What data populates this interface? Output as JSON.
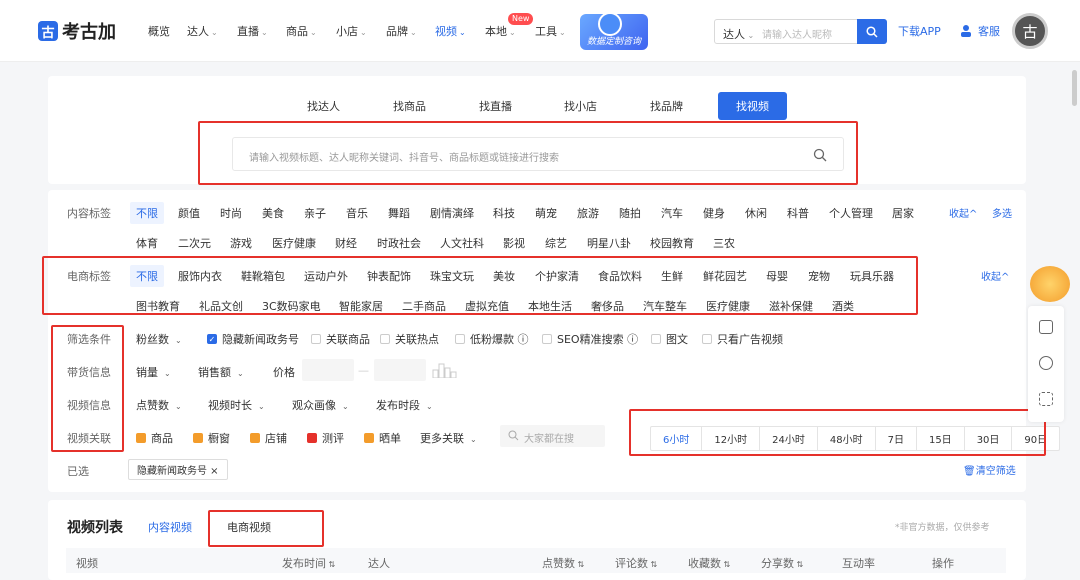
{
  "brand": {
    "name": "考古加",
    "mark": "古"
  },
  "nav": {
    "items": [
      {
        "label": "概览",
        "has_caret": false
      },
      {
        "label": "达人",
        "has_caret": true
      },
      {
        "label": "直播",
        "has_caret": true
      },
      {
        "label": "商品",
        "has_caret": true
      },
      {
        "label": "小店",
        "has_caret": true
      },
      {
        "label": "品牌",
        "has_caret": true
      },
      {
        "label": "视频",
        "has_caret": true,
        "active": true
      },
      {
        "label": "本地",
        "has_caret": true
      },
      {
        "label": "工具",
        "has_caret": true
      }
    ],
    "new_badge": "New",
    "promo_text": "数据定制咨询",
    "search_scope": "达人",
    "search_placeholder": "请输入达人昵称",
    "download": "下载APP",
    "service": "客服",
    "avatar_char": "古"
  },
  "find_tabs": [
    {
      "label": "找达人"
    },
    {
      "label": "找商品"
    },
    {
      "label": "找直播"
    },
    {
      "label": "找小店"
    },
    {
      "label": "找品牌"
    },
    {
      "label": "找视频",
      "active": true
    }
  ],
  "main_search": {
    "placeholder": "请输入视频标题、达人昵称关键词、抖音号、商品标题或链接进行搜索"
  },
  "content_tags": {
    "label": "内容标签",
    "row1": [
      "不限",
      "颜值",
      "时尚",
      "美食",
      "亲子",
      "音乐",
      "舞蹈",
      "剧情演绎",
      "科技",
      "萌宠",
      "旅游",
      "随拍",
      "汽车",
      "健身",
      "休闲",
      "科普",
      "个人管理",
      "居家"
    ],
    "row2": [
      "体育",
      "二次元",
      "游戏",
      "医疗健康",
      "财经",
      "时政社会",
      "人文社科",
      "影视",
      "综艺",
      "明星八卦",
      "校园教育",
      "三农"
    ],
    "collapse": "收起^",
    "multi": "多选"
  },
  "ecom_tags": {
    "label": "电商标签",
    "row1": [
      "不限",
      "服饰内衣",
      "鞋靴箱包",
      "运动户外",
      "钟表配饰",
      "珠宝文玩",
      "美妆",
      "个护家清",
      "食品饮料",
      "生鲜",
      "鲜花园艺",
      "母婴",
      "宠物",
      "玩具乐器"
    ],
    "row2": [
      "图书教育",
      "礼品文创",
      "3C数码家电",
      "智能家居",
      "二手商品",
      "虚拟充值",
      "本地生活",
      "奢侈品",
      "汽车整车",
      "医疗健康",
      "滋补保健",
      "酒类"
    ],
    "collapse": "收起^"
  },
  "filters": {
    "screen_label": "筛选条件",
    "fans": "粉丝数",
    "checks": [
      {
        "label": "隐藏新闻政务号",
        "checked": true
      },
      {
        "label": "关联商品",
        "checked": false
      },
      {
        "label": "关联热点",
        "checked": false
      },
      {
        "label": "低粉爆款 ⓘ",
        "checked": false
      },
      {
        "label": "SEO精准搜索 ⓘ",
        "checked": false
      },
      {
        "label": "图文",
        "checked": false
      },
      {
        "label": "只看广告视频",
        "checked": false
      }
    ],
    "sales_label": "带货信息",
    "sales": [
      "销量",
      "销售额"
    ],
    "price_label": "价格",
    "price_sep": "—",
    "video_label": "视频信息",
    "video_drops": [
      "点赞数",
      "视频时长",
      "观众画像",
      "发布时段"
    ],
    "relate_label": "视频关联",
    "relates": [
      {
        "label": "商品",
        "color": "#f39c2b"
      },
      {
        "label": "橱窗",
        "color": "#f39c2b"
      },
      {
        "label": "店铺",
        "color": "#f39c2b"
      },
      {
        "label": "测评",
        "color": "#e5312b"
      },
      {
        "label": "晒单",
        "color": "#f39c2b"
      }
    ],
    "more": "更多关联",
    "search_placeholder": "大家都在搜",
    "time_ranges": [
      {
        "label": "6小时",
        "active": true
      },
      {
        "label": "12小时"
      },
      {
        "label": "24小时"
      },
      {
        "label": "48小时"
      },
      {
        "label": "7日"
      },
      {
        "label": "15日"
      },
      {
        "label": "30日"
      },
      {
        "label": "90日"
      }
    ],
    "selected_label": "已选",
    "selected_chip": "隐藏新闻政务号 ×",
    "clear": "清空筛选"
  },
  "list": {
    "title": "视频列表",
    "tabs": [
      {
        "label": "内容视频",
        "active": true
      },
      {
        "label": "电商视频"
      }
    ],
    "note": "*非官方数据，仅供参考",
    "columns": [
      "视频",
      "发布时间",
      "达人",
      "点赞数",
      "评论数",
      "收藏数",
      "分享数",
      "互动率",
      "操作"
    ]
  },
  "colors": {
    "accent": "#2b6be6",
    "highlight": "#e5312b"
  }
}
